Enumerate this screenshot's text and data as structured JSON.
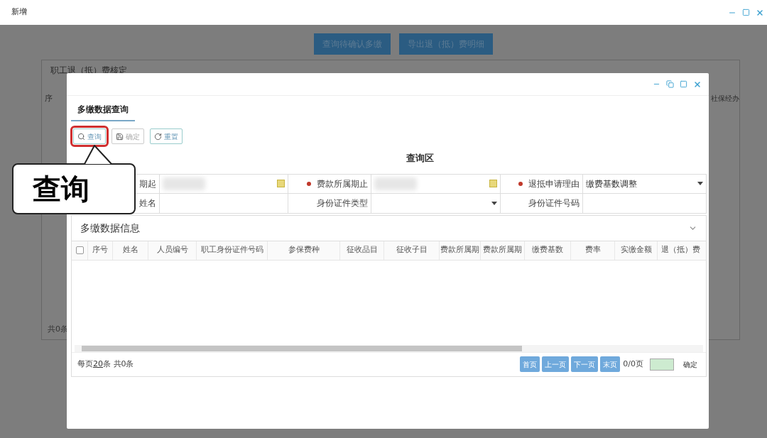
{
  "window": {
    "title": "新增"
  },
  "background": {
    "buttons": [
      "查询待确认多缴",
      "导出退（抵）费明细"
    ],
    "panel_title": "职工退（抵）费核定",
    "column_fragments": [
      "序",
      "社保经办"
    ],
    "footer": "共0条"
  },
  "dialog": {
    "tab": {
      "label": "多缴数据查询",
      "selected": true
    },
    "toolbar": [
      {
        "kind": "search",
        "label": "查询",
        "highlighted": true
      },
      {
        "kind": "save",
        "label": "确定",
        "highlighted": false
      },
      {
        "kind": "reset",
        "label": "重置",
        "highlighted": false
      }
    ],
    "callout": "查询",
    "query_title": "查询区",
    "form": [
      {
        "label": "期起",
        "required": false,
        "kind": "date",
        "redacted": true
      },
      {
        "label": "费款所属期止",
        "required": true,
        "kind": "date",
        "redacted": true
      },
      {
        "label": "退抵申请理由",
        "required": true,
        "kind": "select",
        "value": "缴费基数调整"
      },
      {
        "label": "姓名",
        "required": false,
        "kind": "text"
      },
      {
        "label": "身份证件类型",
        "required": false,
        "kind": "select"
      },
      {
        "label": "身份证件号码",
        "required": false,
        "kind": "text"
      }
    ],
    "grid_title": "多缴数据信息",
    "table": {
      "select_all_checked": false,
      "columns": [
        "序号",
        "姓名",
        "人员编号",
        "职工身份证件号码",
        "参保费种",
        "征收品目",
        "征收子目",
        "费款所属期",
        "费款所属期",
        "缴费基数",
        "费率",
        "实缴金额",
        "退（抵）费"
      ]
    },
    "pager": {
      "per_page_prefix": "每页",
      "per_page": "20",
      "per_page_suffix": "条",
      "total": "共0条",
      "buttons": [
        "首页",
        "上一页",
        "下一页",
        "末页"
      ],
      "pages": "0/0页",
      "go": "确定"
    }
  }
}
